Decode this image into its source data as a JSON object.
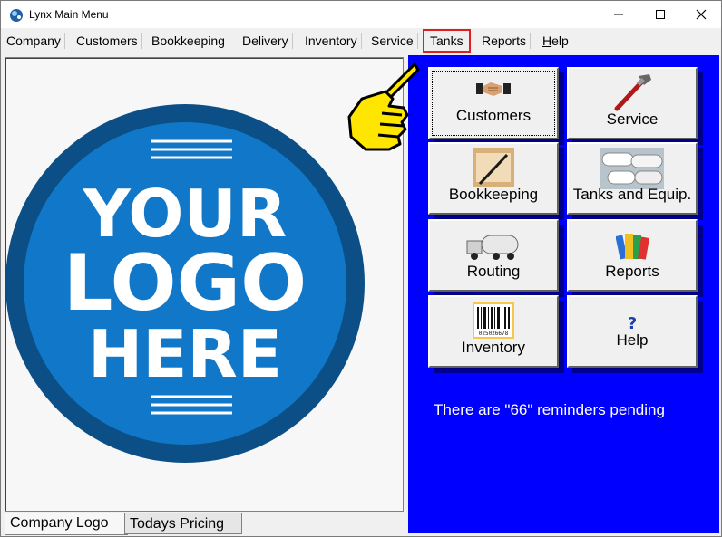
{
  "window": {
    "title": "Lynx Main Menu"
  },
  "menu": [
    {
      "label": "Company",
      "name": "menu-company"
    },
    {
      "label": "Customers",
      "name": "menu-customers"
    },
    {
      "label": "Bookkeeping",
      "name": "menu-bookkeeping"
    },
    {
      "label": "Delivery",
      "name": "menu-delivery"
    },
    {
      "label": "Inventory",
      "name": "menu-inventory"
    },
    {
      "label": "Service",
      "name": "menu-service"
    },
    {
      "label": "Tanks",
      "name": "menu-tanks"
    },
    {
      "label": "Reports",
      "name": "menu-reports"
    },
    {
      "label": "Help",
      "name": "menu-help"
    }
  ],
  "logo": {
    "line1": "YOUR",
    "line2": "LOGO",
    "line3": "HERE"
  },
  "tabs": {
    "company_logo": "Company Logo",
    "todays_pricing": "Todays Pricing"
  },
  "tiles": {
    "customers": "Customers",
    "service": "Service",
    "bookkeeping": "Bookkeeping",
    "tanks": "Tanks and Equip.",
    "routing": "Routing",
    "reports": "Reports",
    "inventory": "Inventory",
    "help": "Help",
    "barcode_digits": "025026678"
  },
  "reminder": "There are \"66\" reminders pending",
  "colors": {
    "panel": "#0000ff",
    "logo_outer": "#0b4f86",
    "logo_inner": "#1177c8",
    "highlight": "#e02020"
  }
}
